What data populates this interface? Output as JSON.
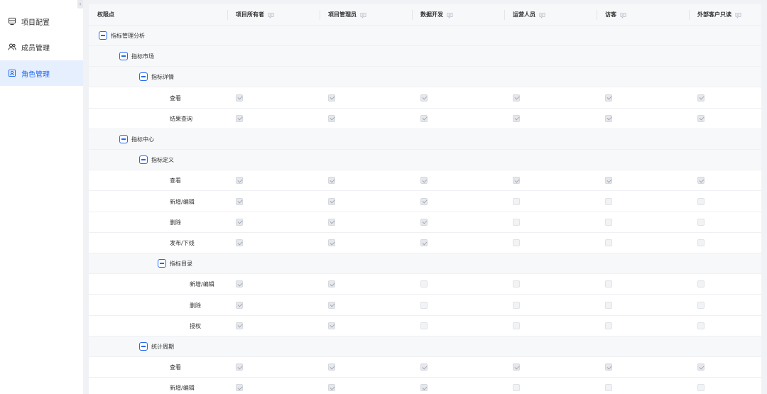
{
  "sidebar": {
    "collapse_glyph": "‹",
    "items": [
      {
        "label": "项目配置",
        "icon": "project-config-icon",
        "active": false
      },
      {
        "label": "成员管理",
        "icon": "members-icon",
        "active": false
      },
      {
        "label": "角色管理",
        "icon": "role-icon",
        "active": true
      }
    ]
  },
  "colors": {
    "accent": "#2468f2",
    "active_bg": "#e6effd",
    "header_bg": "#f7f8fa",
    "group_row_bg": "#f7f8fa"
  },
  "table": {
    "columns": [
      {
        "label": "权限点",
        "filter": false
      },
      {
        "label": "项目所有者",
        "filter": true
      },
      {
        "label": "项目管理员",
        "filter": true
      },
      {
        "label": "数据开发",
        "filter": true
      },
      {
        "label": "运营人员",
        "filter": true
      },
      {
        "label": "访客",
        "filter": true
      },
      {
        "label": "外部客户只读",
        "filter": true
      }
    ],
    "rows": [
      {
        "type": "group",
        "level": 0,
        "label": "指标管理分析"
      },
      {
        "type": "group",
        "level": 1,
        "label": "指标市场"
      },
      {
        "type": "group",
        "level": 2,
        "label": "指标详情"
      },
      {
        "type": "leaf",
        "level": 3,
        "label": "查看",
        "checks": [
          true,
          true,
          true,
          true,
          true,
          true
        ]
      },
      {
        "type": "leaf",
        "level": 3,
        "label": "结果查询",
        "checks": [
          true,
          true,
          true,
          true,
          true,
          true
        ]
      },
      {
        "type": "group",
        "level": 1,
        "label": "指标中心"
      },
      {
        "type": "group",
        "level": 2,
        "label": "指标定义"
      },
      {
        "type": "leaf",
        "level": 3,
        "label": "查看",
        "checks": [
          true,
          true,
          true,
          true,
          true,
          true
        ]
      },
      {
        "type": "leaf",
        "level": 3,
        "label": "新增/编辑",
        "checks": [
          true,
          true,
          true,
          false,
          false,
          false
        ]
      },
      {
        "type": "leaf",
        "level": 3,
        "label": "删除",
        "checks": [
          true,
          true,
          true,
          false,
          false,
          false
        ]
      },
      {
        "type": "leaf",
        "level": 3,
        "label": "发布/下线",
        "checks": [
          true,
          true,
          true,
          false,
          false,
          false
        ]
      },
      {
        "type": "group",
        "level": 3,
        "label": "指标目录"
      },
      {
        "type": "leaf",
        "level": 4,
        "label": "新增/编辑",
        "checks": [
          true,
          true,
          false,
          false,
          false,
          false
        ]
      },
      {
        "type": "leaf",
        "level": 4,
        "label": "删除",
        "checks": [
          true,
          true,
          false,
          false,
          false,
          false
        ]
      },
      {
        "type": "leaf",
        "level": 4,
        "label": "授权",
        "checks": [
          true,
          true,
          false,
          false,
          false,
          false
        ]
      },
      {
        "type": "group",
        "level": 2,
        "label": "统计周期"
      },
      {
        "type": "leaf",
        "level": 3,
        "label": "查看",
        "checks": [
          true,
          true,
          true,
          true,
          true,
          true
        ]
      },
      {
        "type": "leaf",
        "level": 3,
        "label": "新增/编辑",
        "checks": [
          true,
          true,
          true,
          false,
          false,
          false
        ]
      }
    ]
  }
}
